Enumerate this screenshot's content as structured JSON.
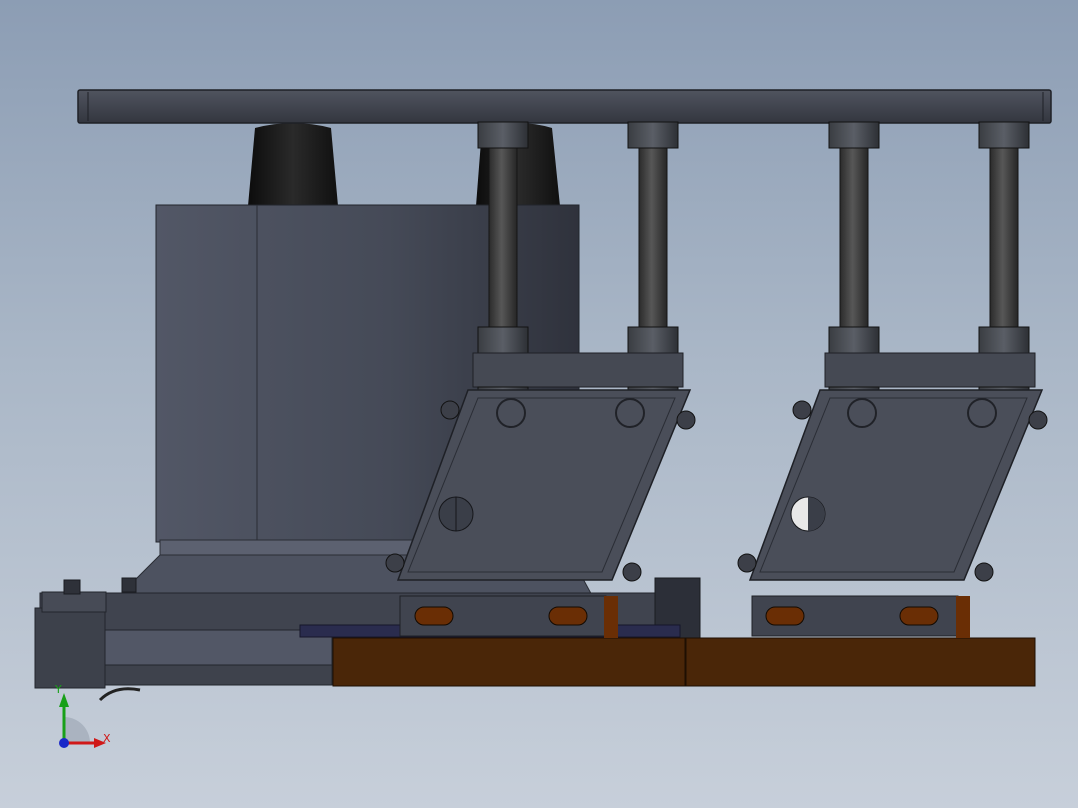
{
  "viewport": {
    "background_top": "#8c9db4",
    "background_bottom": "#c7cfda"
  },
  "model": {
    "colors": {
      "steel_dark": "#3a3e48",
      "steel_mid": "#4b4f5b",
      "steel_light": "#5d6270",
      "rubber": "#151515",
      "wood": "#4a2608",
      "slot": "#6a2e05"
    }
  },
  "triad": {
    "x_label": "X",
    "y_label": "Y",
    "x_color": "#d01818",
    "y_color": "#18a018",
    "z_color": "#1a28c8"
  }
}
